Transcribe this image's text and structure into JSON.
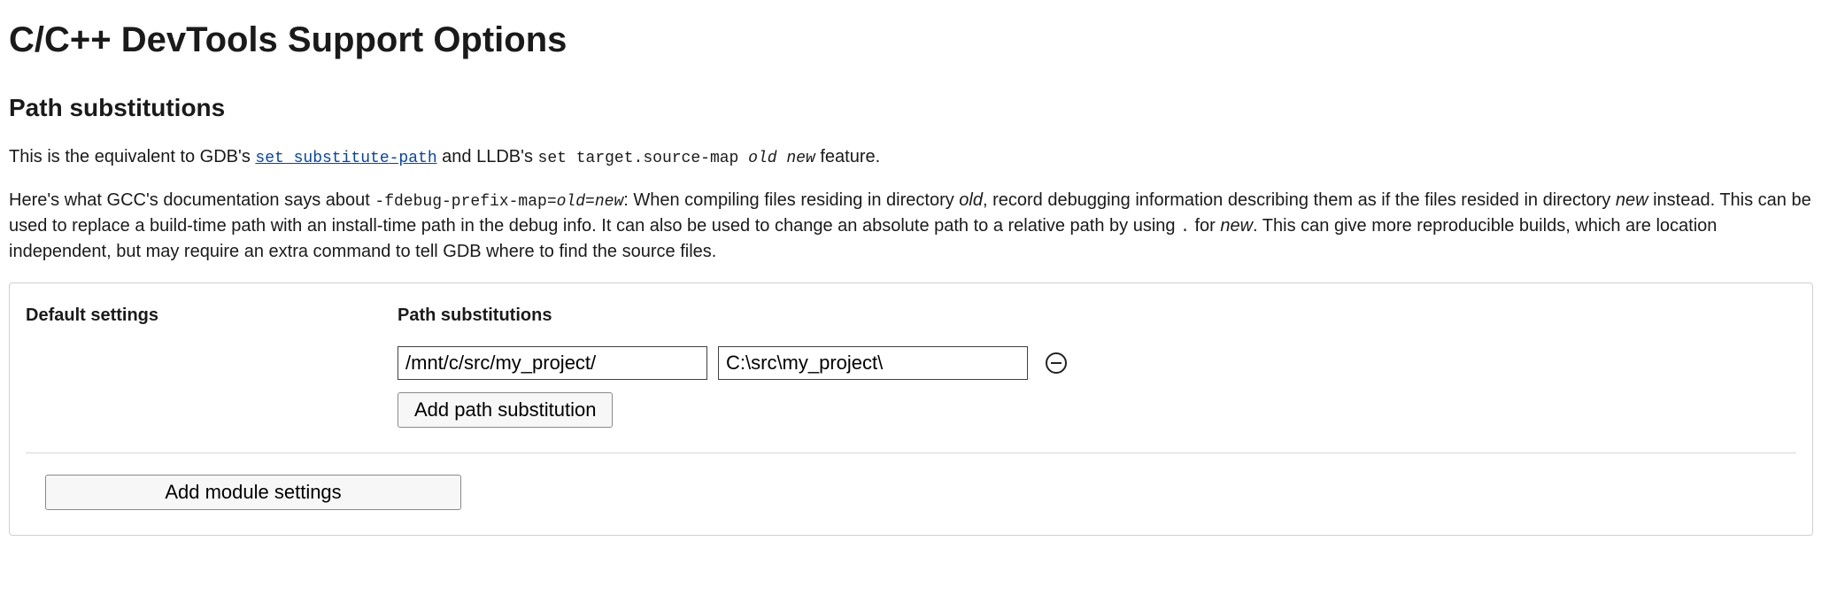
{
  "page_title": "C/C++ DevTools Support Options",
  "section_title": "Path substitutions",
  "intro": {
    "pre_gdb": "This is the equivalent to GDB's ",
    "gdb_link_text": "set substitute-path",
    "mid": " and LLDB's ",
    "lldb_cmd": "set target.source-map ",
    "lldb_old": "old",
    "lldb_new": " new",
    "post": " feature."
  },
  "gcc": {
    "pre": "Here's what GCC's documentation says about ",
    "flag_a": "-fdebug-prefix-map=",
    "flag_old": "old",
    "flag_eq": "=",
    "flag_new": "new",
    "after_colon": ": When compiling files residing in directory ",
    "old2": "old",
    "after_old2": ", record debugging information describing them as if the files resided in directory ",
    "new2": "new",
    "after_new2": " instead. This can be used to replace a build-time path with an install-time path in the debug info. It can also be used to change an absolute path to a relative path by using ",
    "dot": ".",
    "after_dot": " for ",
    "new3": "new",
    "tail": ". This can give more reproducible builds, which are location independent, but may require an extra command to tell GDB where to find the source files."
  },
  "panel": {
    "default_settings_label": "Default settings",
    "path_sub_label": "Path substitutions",
    "row": {
      "from": "/mnt/c/src/my_project/",
      "to": "C:\\src\\my_project\\"
    },
    "add_button_label": "Add path substitution",
    "add_module_label": "Add module settings"
  }
}
